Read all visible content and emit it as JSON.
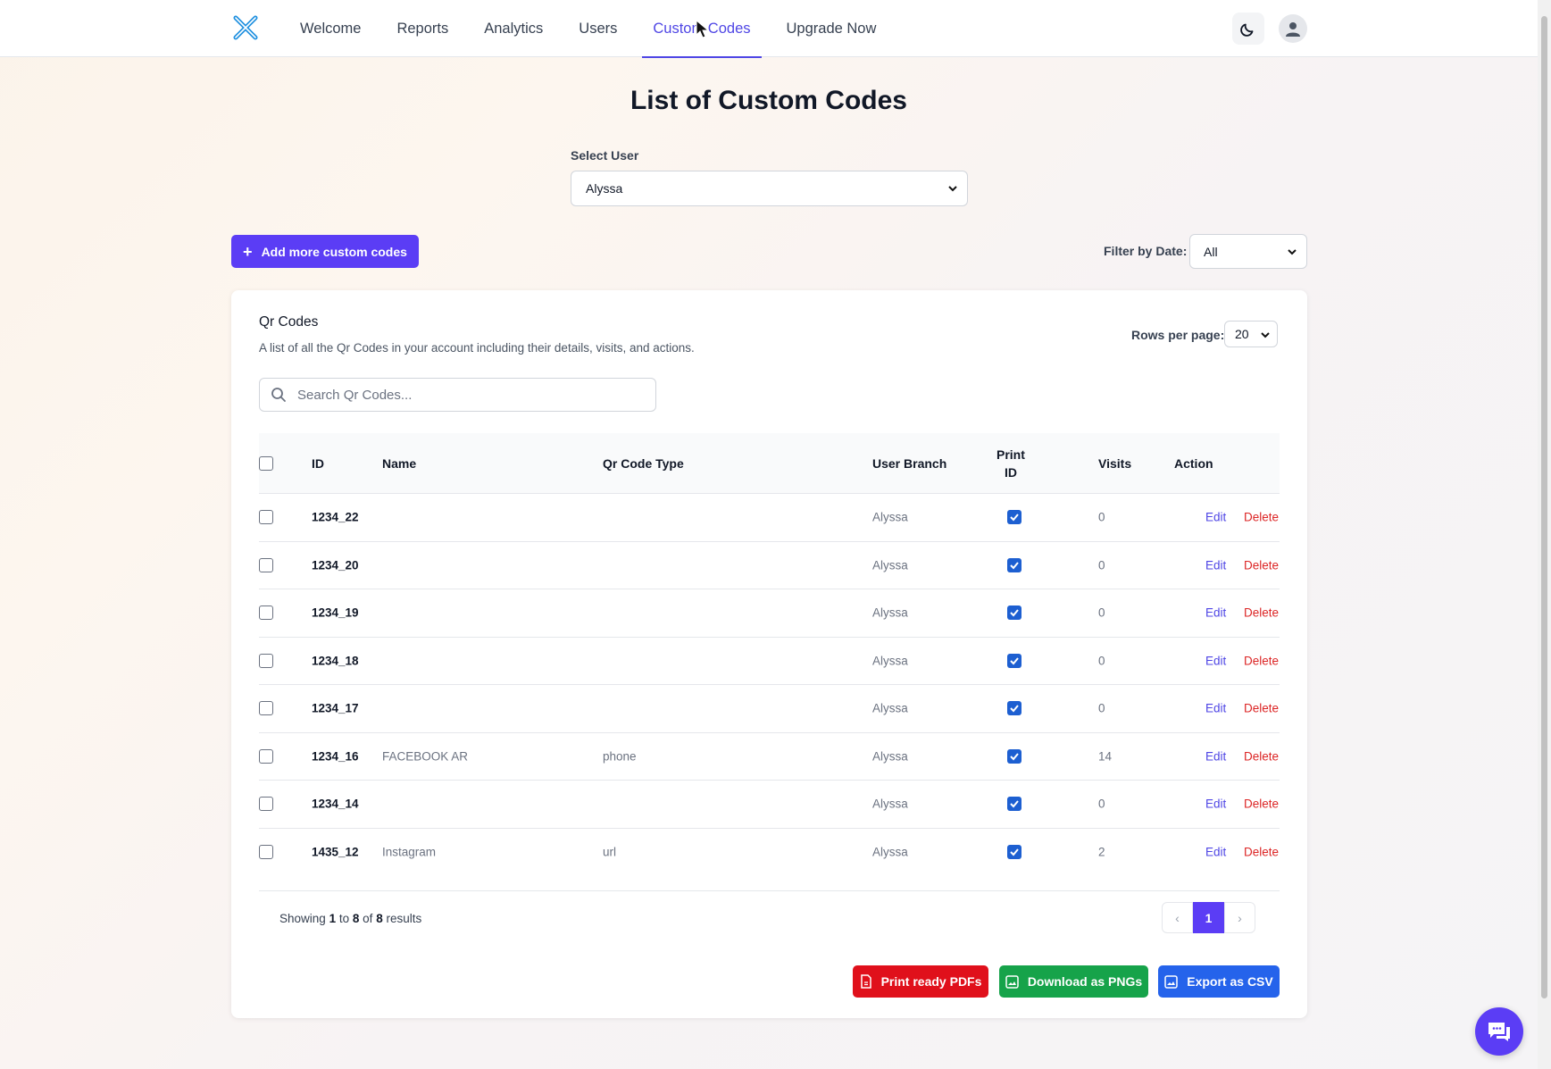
{
  "nav": {
    "items": [
      {
        "label": "Welcome",
        "active": false
      },
      {
        "label": "Reports",
        "active": false
      },
      {
        "label": "Analytics",
        "active": false
      },
      {
        "label": "Users",
        "active": false
      },
      {
        "label": "Custom Codes",
        "active": true
      },
      {
        "label": "Upgrade Now",
        "active": false
      }
    ],
    "icons": {
      "logo": "x-logo-icon",
      "theme": "moon-icon",
      "profile": "user-icon"
    }
  },
  "page": {
    "title": "List of Custom Codes",
    "select_user_label": "Select User",
    "select_user_value": "Alyssa",
    "add_button": "Add more custom codes",
    "filter_label": "Filter by Date:",
    "filter_value": "All"
  },
  "card": {
    "title": "Qr Codes",
    "description": "A list of all the Qr Codes in your account including their details, visits, and actions.",
    "rows_label": "Rows per page:",
    "rows_value": "20",
    "search_placeholder": "Search Qr Codes..."
  },
  "table": {
    "headers": {
      "id": "ID",
      "name": "Name",
      "type": "Qr Code Type",
      "branch": "User Branch",
      "print_1": "Print",
      "print_2": "ID",
      "visits": "Visits",
      "action": "Action"
    },
    "rows": [
      {
        "id": "1234_22",
        "name": "",
        "type": "",
        "branch": "Alyssa",
        "print": true,
        "visits": "0",
        "edit": "Edit",
        "delete": "Delete"
      },
      {
        "id": "1234_20",
        "name": "",
        "type": "",
        "branch": "Alyssa",
        "print": true,
        "visits": "0",
        "edit": "Edit",
        "delete": "Delete"
      },
      {
        "id": "1234_19",
        "name": "",
        "type": "",
        "branch": "Alyssa",
        "print": true,
        "visits": "0",
        "edit": "Edit",
        "delete": "Delete"
      },
      {
        "id": "1234_18",
        "name": "",
        "type": "",
        "branch": "Alyssa",
        "print": true,
        "visits": "0",
        "edit": "Edit",
        "delete": "Delete"
      },
      {
        "id": "1234_17",
        "name": "",
        "type": "",
        "branch": "Alyssa",
        "print": true,
        "visits": "0",
        "edit": "Edit",
        "delete": "Delete"
      },
      {
        "id": "1234_16",
        "name": "FACEBOOK AR",
        "type": "phone",
        "branch": "Alyssa",
        "print": true,
        "visits": "14",
        "edit": "Edit",
        "delete": "Delete"
      },
      {
        "id": "1234_14",
        "name": "",
        "type": "",
        "branch": "Alyssa",
        "print": true,
        "visits": "0",
        "edit": "Edit",
        "delete": "Delete"
      },
      {
        "id": "1435_12",
        "name": "Instagram",
        "type": "url",
        "branch": "Alyssa",
        "print": true,
        "visits": "2",
        "edit": "Edit",
        "delete": "Delete"
      }
    ]
  },
  "pagination": {
    "showing_prefix": "Showing",
    "from": "1",
    "to_word": "to",
    "to": "8",
    "of_word": "of",
    "total": "8",
    "results_word": "results",
    "current_page": "1",
    "prev_glyph": "‹",
    "next_glyph": "›"
  },
  "actions": {
    "print_pdfs": "Print ready PDFs",
    "download_pngs": "Download as PNGs",
    "export_csv": "Export as CSV"
  },
  "colors": {
    "accent": "#5b3df5",
    "nav_active": "#4f46e5",
    "delete": "#dc2626",
    "print_btn": "#e0101b",
    "png_btn": "#16a34a",
    "csv_btn": "#2563eb"
  }
}
